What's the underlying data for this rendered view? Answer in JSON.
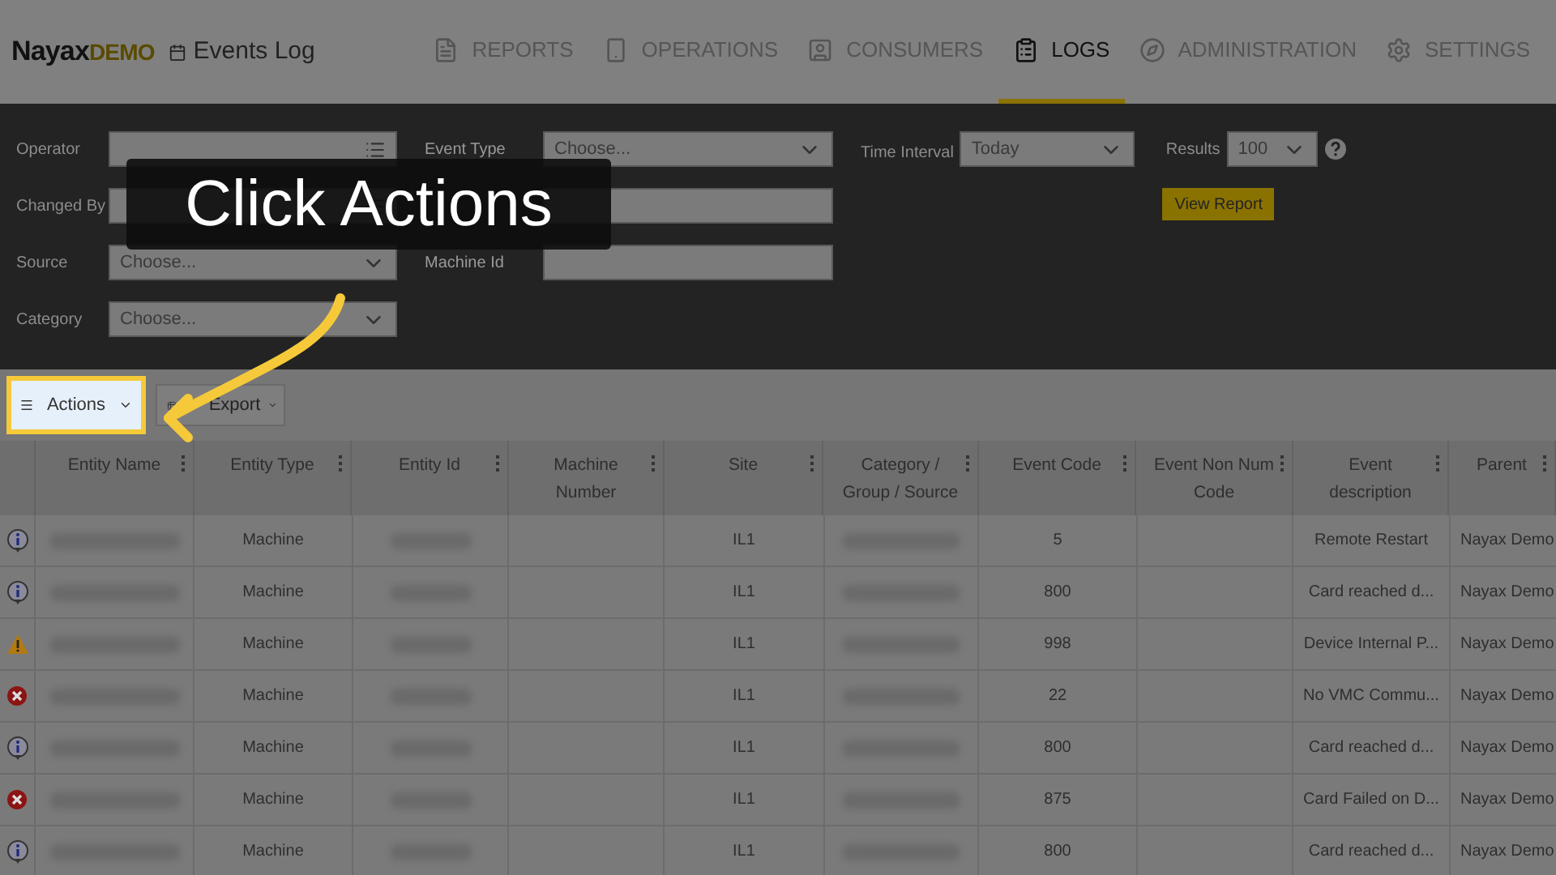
{
  "header": {
    "logo": {
      "brand": "Nayax",
      "tag": "DEMO"
    },
    "page_title": "Events Log"
  },
  "nav": [
    {
      "label": "REPORTS",
      "selected": false
    },
    {
      "label": "OPERATIONS",
      "selected": false
    },
    {
      "label": "CONSUMERS",
      "selected": false
    },
    {
      "label": "LOGS",
      "selected": true
    },
    {
      "label": "ADMINISTRATION",
      "selected": false
    },
    {
      "label": "SETTINGS",
      "selected": false
    }
  ],
  "filters": {
    "col1": [
      {
        "label": "Operator",
        "kind": "list"
      },
      {
        "label": "Changed By",
        "kind": "list"
      },
      {
        "label": "Source",
        "kind": "select",
        "placeholder": "Choose..."
      },
      {
        "label": "Category",
        "kind": "select",
        "placeholder": "Choose..."
      }
    ],
    "col2": [
      {
        "label": "Event Type",
        "kind": "select",
        "placeholder": "Choose..."
      },
      {
        "kind": "text"
      },
      {
        "label": "Machine Id",
        "kind": "text"
      }
    ],
    "time_interval": {
      "label": "Time Interval",
      "value": "Today"
    },
    "results": {
      "label": "Results",
      "value": "100"
    },
    "view_report": "View Report"
  },
  "toolbar": {
    "actions": {
      "label": "Actions",
      "highlighted": true
    },
    "export": {
      "label": "Export"
    }
  },
  "table": {
    "columns": [
      "Entity Name",
      "Entity Type",
      "Entity Id",
      "Machine Number",
      "Site",
      "Category / Group / Source",
      "Event Code",
      "Event Non Num Code",
      "Event description",
      "Parent"
    ],
    "rows": [
      {
        "kind": "info",
        "entity_type": "Machine",
        "site": "IL1",
        "event_code": "5",
        "description": "Remote Restart",
        "parent": "Nayax Demo"
      },
      {
        "kind": "info",
        "entity_type": "Machine",
        "site": "IL1",
        "event_code": "800",
        "description": "Card reached d...",
        "parent": "Nayax Demo"
      },
      {
        "kind": "warning",
        "entity_type": "Machine",
        "site": "IL1",
        "event_code": "998",
        "description": "Device Internal P...",
        "parent": "Nayax Demo"
      },
      {
        "kind": "error",
        "entity_type": "Machine",
        "site": "IL1",
        "event_code": "22",
        "description": "No VMC Commu...",
        "parent": "Nayax Demo"
      },
      {
        "kind": "info",
        "entity_type": "Machine",
        "site": "IL1",
        "event_code": "800",
        "description": "Card reached d...",
        "parent": "Nayax Demo"
      },
      {
        "kind": "error",
        "entity_type": "Machine",
        "site": "IL1",
        "event_code": "875",
        "description": "Card Failed on D...",
        "parent": "Nayax Demo"
      },
      {
        "kind": "info",
        "entity_type": "Machine",
        "site": "IL1",
        "event_code": "800",
        "description": "Card reached d...",
        "parent": "Nayax Demo"
      }
    ]
  },
  "callout": {
    "text": "Click Actions"
  }
}
